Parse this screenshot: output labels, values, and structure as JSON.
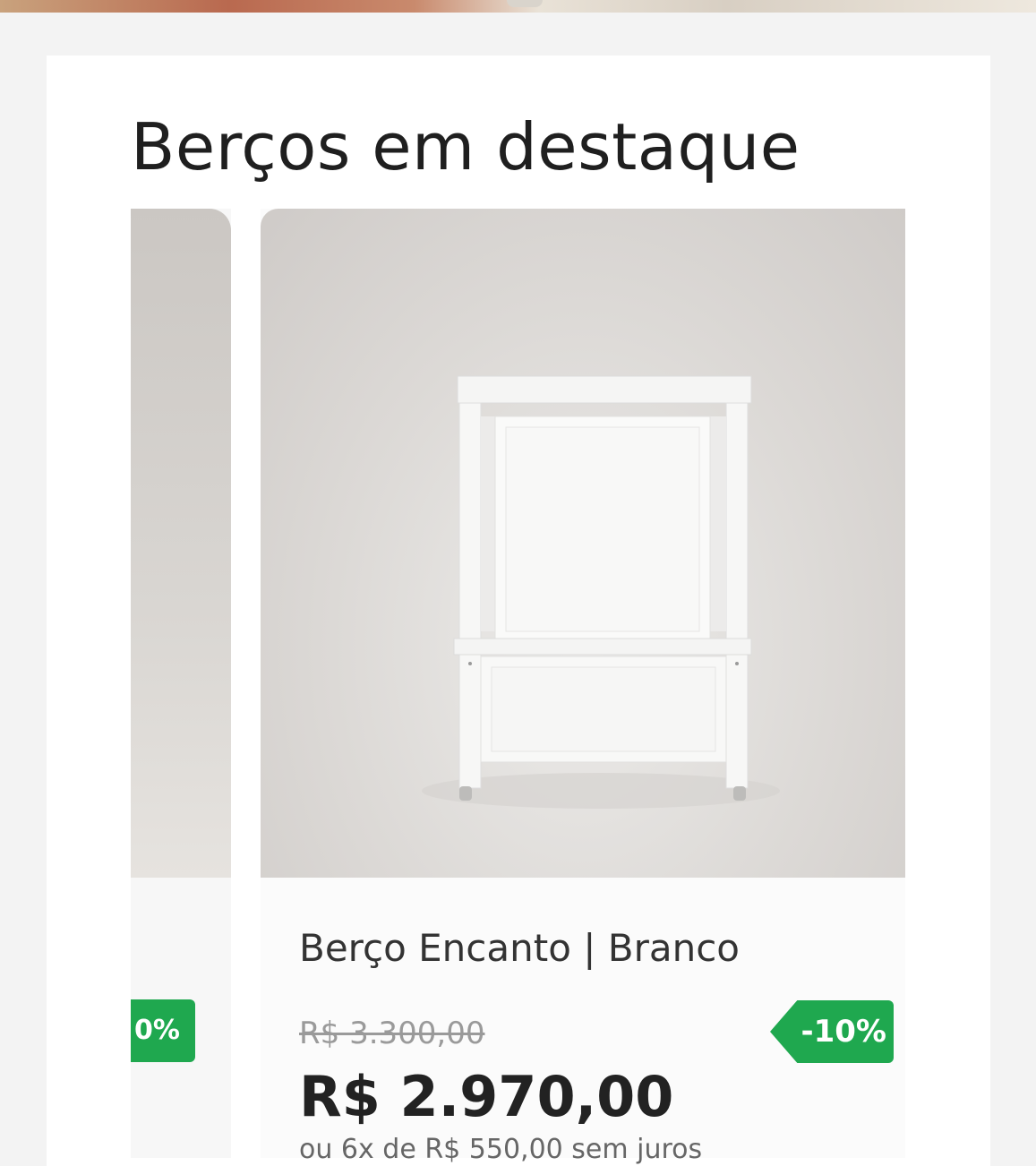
{
  "section": {
    "title": "Berços em destaque"
  },
  "prev_card": {
    "discount_text": "0%"
  },
  "product": {
    "name": "Berço Encanto | Branco",
    "old_price": "R$ 3.300,00",
    "price": "R$ 2.970,00",
    "discount": "-10%",
    "installment": "ou 6x de R$ 550,00 sem juros"
  },
  "colors": {
    "discount_green": "#1fa84f",
    "title_text": "#1f1f1f",
    "card_bg": "#ffffff"
  }
}
